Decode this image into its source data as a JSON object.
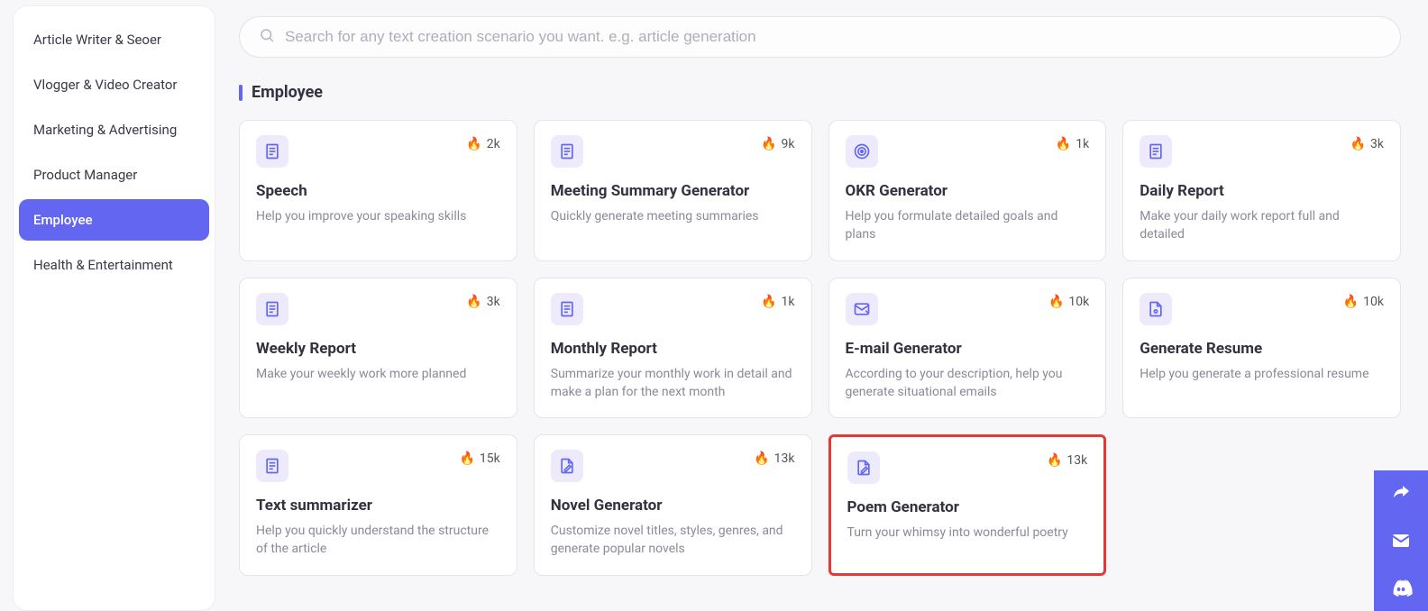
{
  "sidebar": {
    "items": [
      {
        "label": "Article Writer & Seoer"
      },
      {
        "label": "Vlogger & Video Creator"
      },
      {
        "label": "Marketing & Advertising"
      },
      {
        "label": "Product Manager"
      },
      {
        "label": "Employee"
      },
      {
        "label": "Health & Entertainment"
      }
    ],
    "active_index": 4
  },
  "search": {
    "placeholder": "Search for any text creation scenario you want. e.g. article generation",
    "value": ""
  },
  "section": {
    "title": "Employee"
  },
  "cards": [
    {
      "icon": "doc",
      "heat": "2k",
      "title": "Speech",
      "desc": "Help you improve your speaking skills"
    },
    {
      "icon": "doc",
      "heat": "9k",
      "title": "Meeting Summary Generator",
      "desc": "Quickly generate meeting summaries"
    },
    {
      "icon": "target",
      "heat": "1k",
      "title": "OKR Generator",
      "desc": "Help you formulate detailed goals and plans"
    },
    {
      "icon": "doc",
      "heat": "3k",
      "title": "Daily Report",
      "desc": "Make your daily work report full and detailed"
    },
    {
      "icon": "doc",
      "heat": "3k",
      "title": "Weekly Report",
      "desc": "Make your weekly work more planned"
    },
    {
      "icon": "doc",
      "heat": "1k",
      "title": "Monthly Report",
      "desc": "Summarize your monthly work in detail and make a plan for the next month"
    },
    {
      "icon": "mail",
      "heat": "10k",
      "title": "E-mail Generator",
      "desc": "According to your description, help you generate situational emails"
    },
    {
      "icon": "file",
      "heat": "10k",
      "title": "Generate Resume",
      "desc": "Help you generate a professional resume"
    },
    {
      "icon": "doc",
      "heat": "15k",
      "title": "Text summarizer",
      "desc": "Help you quickly understand the structure of the article"
    },
    {
      "icon": "edit",
      "heat": "13k",
      "title": "Novel Generator",
      "desc": "Customize novel titles, styles, genres, and generate popular novels"
    },
    {
      "icon": "edit",
      "heat": "13k",
      "title": "Poem Generator",
      "desc": "Turn your whimsy into wonderful poetry",
      "highlight": true
    }
  ],
  "colors": {
    "accent": "#6366f1",
    "highlight_border": "#e53935"
  }
}
